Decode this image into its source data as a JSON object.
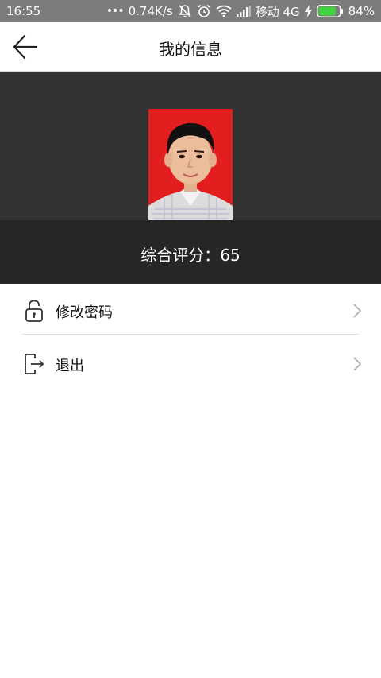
{
  "status_bar": {
    "time": "16:55",
    "speed": "0.74K/s",
    "carrier": "移动 4G",
    "battery": "84%",
    "battery_fill": 0.84
  },
  "header": {
    "title": "我的信息"
  },
  "profile": {
    "score_text": "综合评分：65"
  },
  "menu": {
    "items": [
      {
        "label": "修改密码",
        "icon": "lock-icon"
      },
      {
        "label": "退出",
        "icon": "logout-icon"
      }
    ]
  },
  "colors": {
    "status_bar": "#7c7c7c",
    "profile_bg": "#333333",
    "score_bg": "#262626",
    "photo_bg": "#e31e1e",
    "battery": "#3fd13f"
  }
}
